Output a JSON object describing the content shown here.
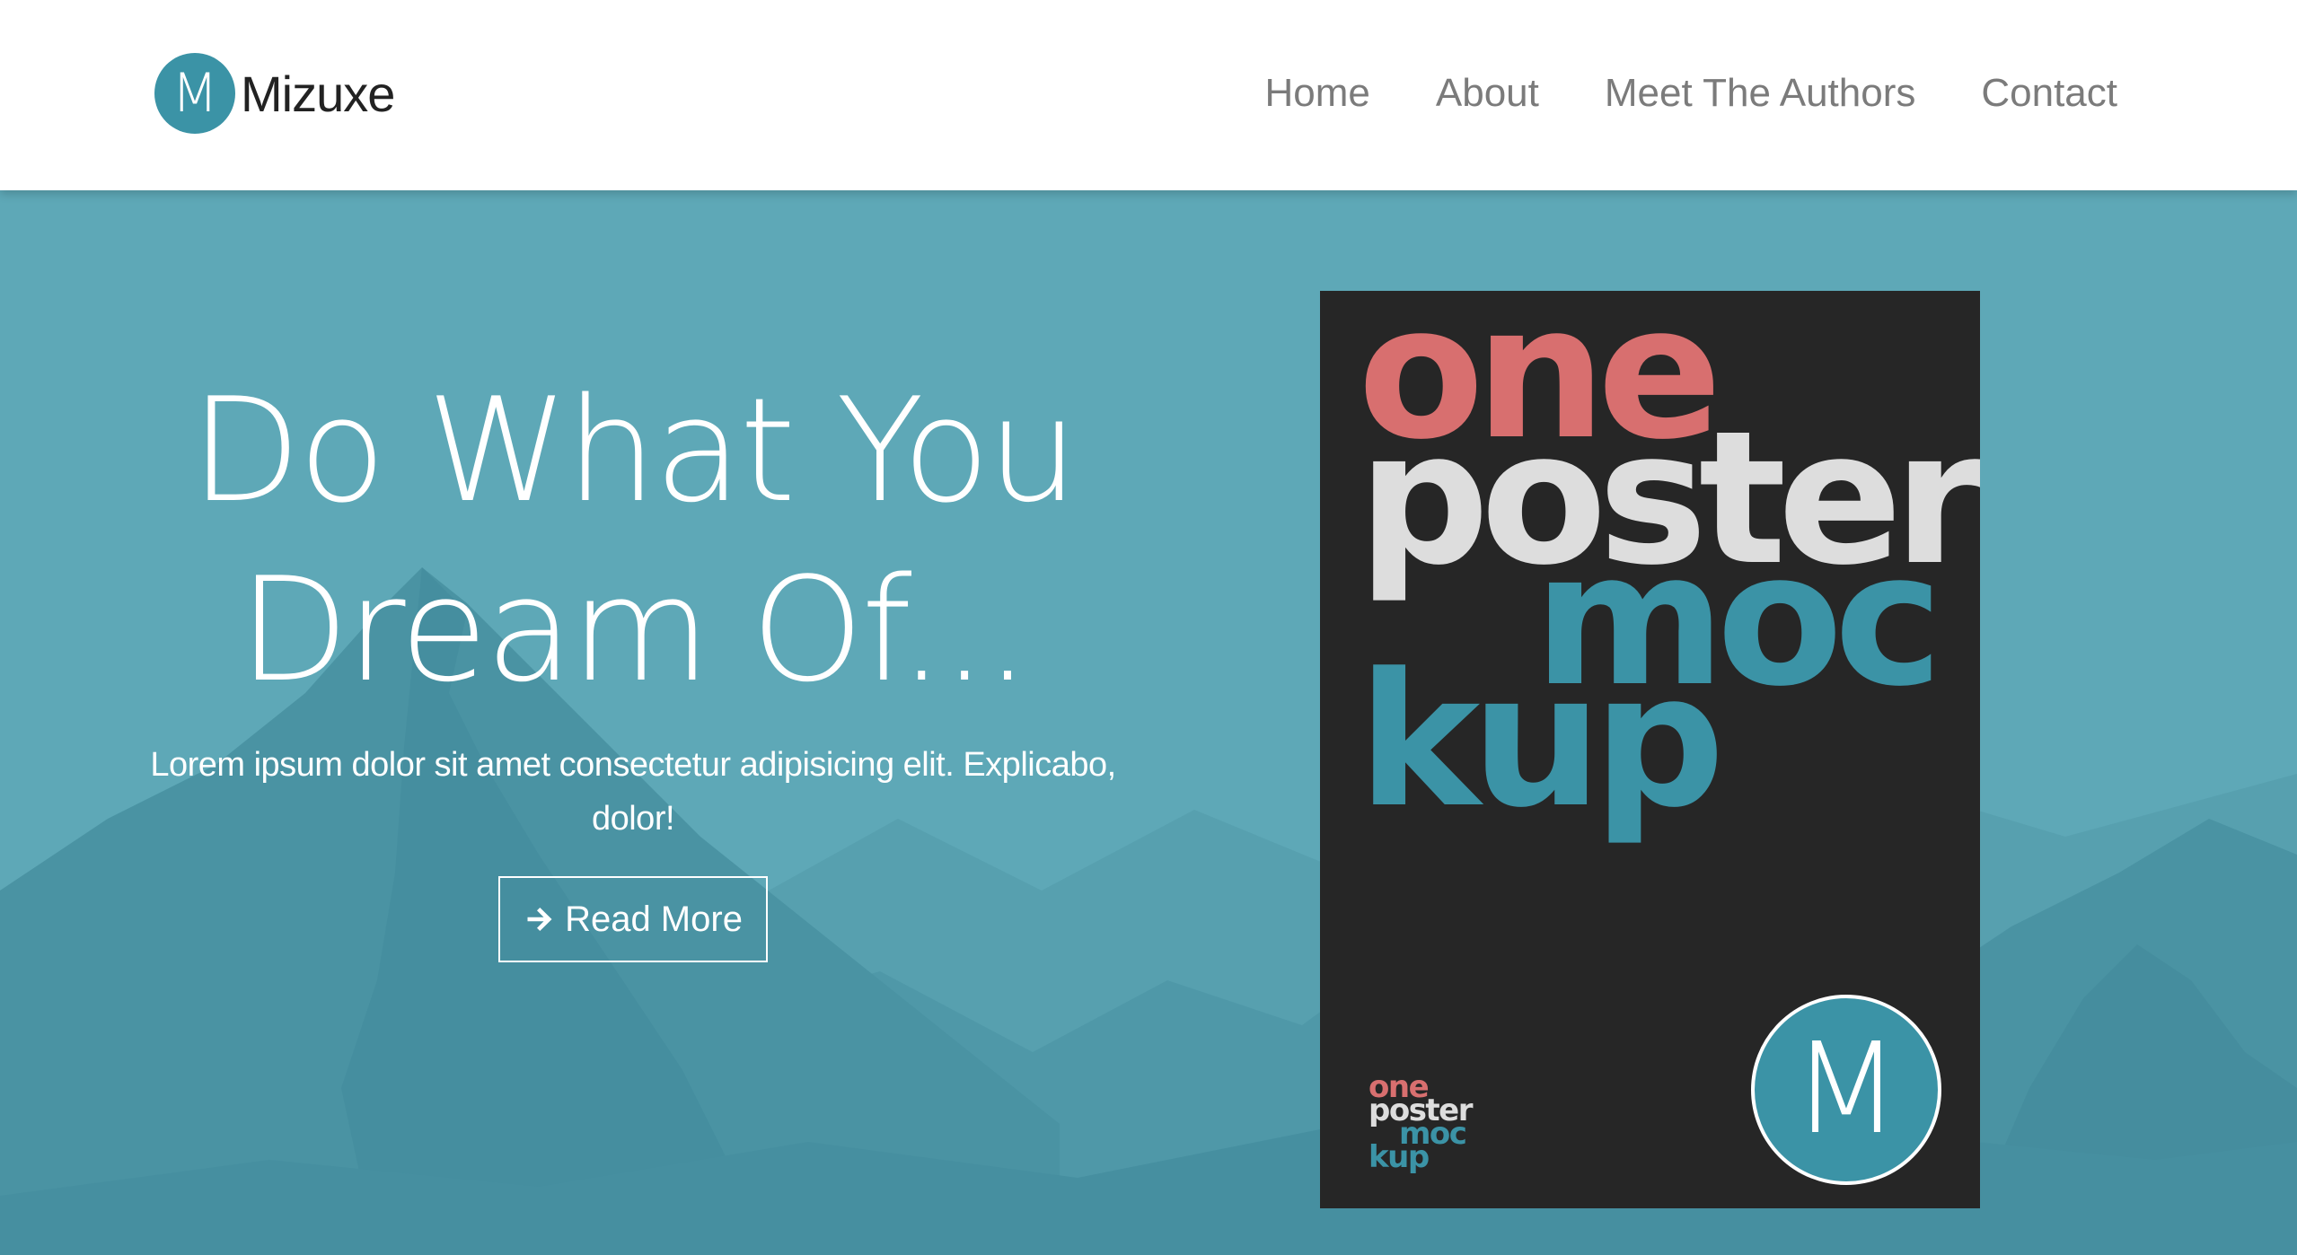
{
  "navbar": {
    "logo_letter": "M",
    "brand_name": "Mizuxe",
    "links": [
      "Home",
      "About",
      "Meet The Authors",
      "Contact"
    ]
  },
  "hero": {
    "title_line1": "Do What You",
    "title_line2": "Dream Of...",
    "text": "Lorem ipsum dolor sit amet consectetur adipisicing elit. Explicabo, dolor!",
    "button_label": "Read More",
    "button_icon": "arrow-right-icon"
  },
  "poster": {
    "words": [
      "one",
      "poster",
      "moc",
      "kup"
    ],
    "small_words": [
      "one",
      "poster",
      "moc",
      "kup"
    ],
    "logo_letter": "M"
  },
  "colors": {
    "accent": "#3b93a6",
    "hero_bg": "#5ea8b7",
    "poster_bg": "#262626",
    "poster_red": "#d86f6f",
    "poster_light": "#dddddd",
    "nav_text": "#7b7b7b"
  }
}
